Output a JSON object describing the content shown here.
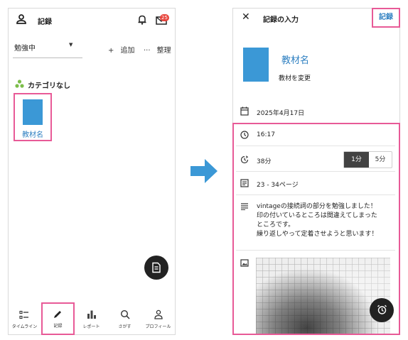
{
  "left": {
    "header_title": "記録",
    "notification_badge": "25",
    "subject_select_value": "勉強中",
    "add_label": "追加",
    "organize_label": "整理",
    "category_title": "カテゴリなし",
    "material_name": "教材名",
    "nav": [
      {
        "label": "タイムライン",
        "icon": "timeline-icon"
      },
      {
        "label": "記録",
        "icon": "pencil-icon"
      },
      {
        "label": "レポート",
        "icon": "bar-chart-icon"
      },
      {
        "label": "さがす",
        "icon": "search-icon"
      },
      {
        "label": "プロフィール",
        "icon": "profile-icon"
      }
    ],
    "active_nav_index": 1
  },
  "right": {
    "header_title": "記録の入力",
    "record_button_label": "記録",
    "material_name": "教材名",
    "change_material_label": "教材を変更",
    "date": "2025年4月17日",
    "time": "16:17",
    "duration": "38分",
    "step_options": [
      "1分",
      "5分"
    ],
    "selected_step_index": 0,
    "pages": "23 - 34ページ",
    "memo_lines": [
      "vintageの接続詞の部分を勉強しました！",
      "印の付いているところは間違えてしまった",
      "ところです。",
      "繰り返しやって定着させようと思います！"
    ]
  },
  "colors": {
    "accent_blue": "#2d7fc1",
    "highlight_pink": "#e85a97",
    "material_cover": "#3b98d6",
    "arrow": "#3b98d6",
    "badge_red": "#e8453c",
    "dark_button": "#222222"
  }
}
